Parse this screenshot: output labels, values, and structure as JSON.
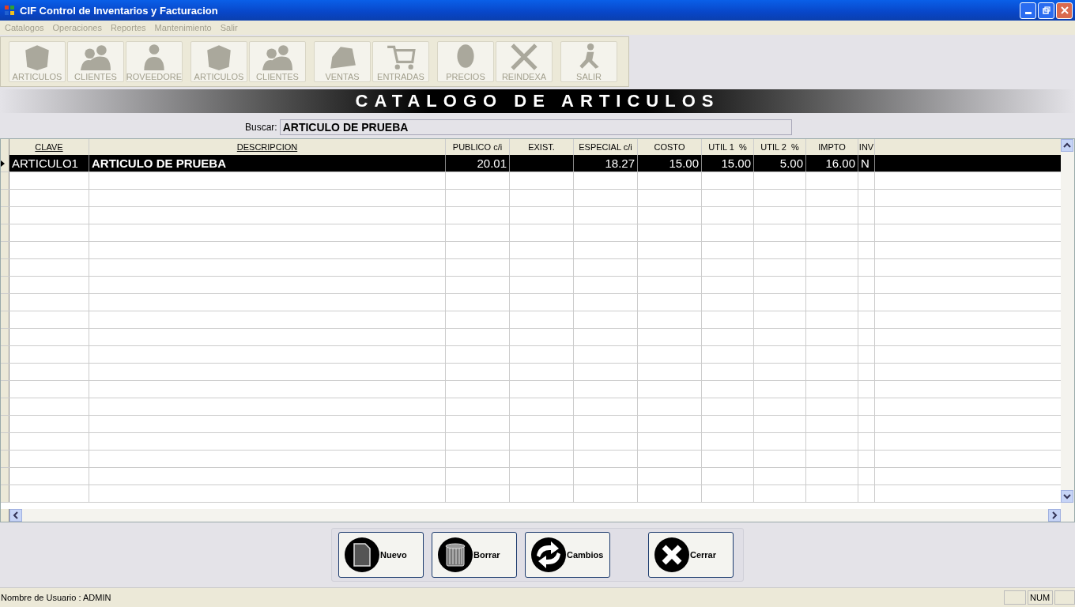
{
  "window": {
    "title": "CIF Control de Inventarios y Facturacion"
  },
  "menu": [
    {
      "label": "Catalogos",
      "disabled": true
    },
    {
      "label": "Operaciones",
      "disabled": true
    },
    {
      "label": "Reportes",
      "disabled": true
    },
    {
      "label": "Mantenimiento",
      "disabled": true
    },
    {
      "label": "Salir",
      "disabled": true
    }
  ],
  "toolbar": [
    [
      {
        "label": "ARTICULOS",
        "kind": "box",
        "disabled": true
      },
      {
        "label": "CLIENTES",
        "kind": "people",
        "disabled": true
      },
      {
        "label": "ROVEEDORE",
        "kind": "person",
        "disabled": true
      }
    ],
    [
      {
        "label": "ARTICULOS",
        "kind": "box",
        "disabled": true
      },
      {
        "label": "CLIENTES",
        "kind": "people",
        "disabled": true
      }
    ],
    [
      {
        "label": "VENTAS",
        "kind": "stone",
        "disabled": true
      },
      {
        "label": "ENTRADAS",
        "kind": "cart",
        "disabled": true
      }
    ],
    [
      {
        "label": "PRECIOS",
        "kind": "head",
        "disabled": true
      },
      {
        "label": "REINDEXA",
        "kind": "tools",
        "disabled": true
      }
    ],
    [
      {
        "label": "SALIR",
        "kind": "runner",
        "disabled": true
      }
    ]
  ],
  "banner": "CATALOGO DE ARTICULOS",
  "search": {
    "label": "Buscar:",
    "value": "ARTICULO DE PRUEBA"
  },
  "table": {
    "columns": [
      {
        "label": "CLAVE",
        "sortable": true
      },
      {
        "label": "DESCRIPCION",
        "sortable": true
      },
      {
        "label": "PUBLICO c/i",
        "sortable": false
      },
      {
        "label": "EXIST.",
        "sortable": false
      },
      {
        "label": "ESPECIAL c/i",
        "sortable": false
      },
      {
        "label": "COSTO",
        "sortable": false
      },
      {
        "label": "UTIL 1  %",
        "sortable": false
      },
      {
        "label": "UTIL 2  %",
        "sortable": false
      },
      {
        "label": "IMPTO",
        "sortable": false
      },
      {
        "label": "INV",
        "sortable": false
      }
    ],
    "rows": [
      {
        "selected": true,
        "cells": [
          "ARTICULO1",
          "ARTICULO DE PRUEBA",
          "20.01",
          "",
          "18.27",
          "15.00",
          "15.00",
          "5.00",
          "16.00",
          "N"
        ]
      }
    ]
  },
  "buttons": [
    {
      "label": "Nuevo",
      "kind": "new"
    },
    {
      "label": "Borrar",
      "kind": "delete"
    },
    {
      "label": "Cambios",
      "kind": "changes"
    },
    {
      "label": "Cerrar",
      "kind": "close"
    }
  ],
  "status_bar": {
    "user": "Nombre de Usuario : ADMIN",
    "num": "NUM"
  }
}
